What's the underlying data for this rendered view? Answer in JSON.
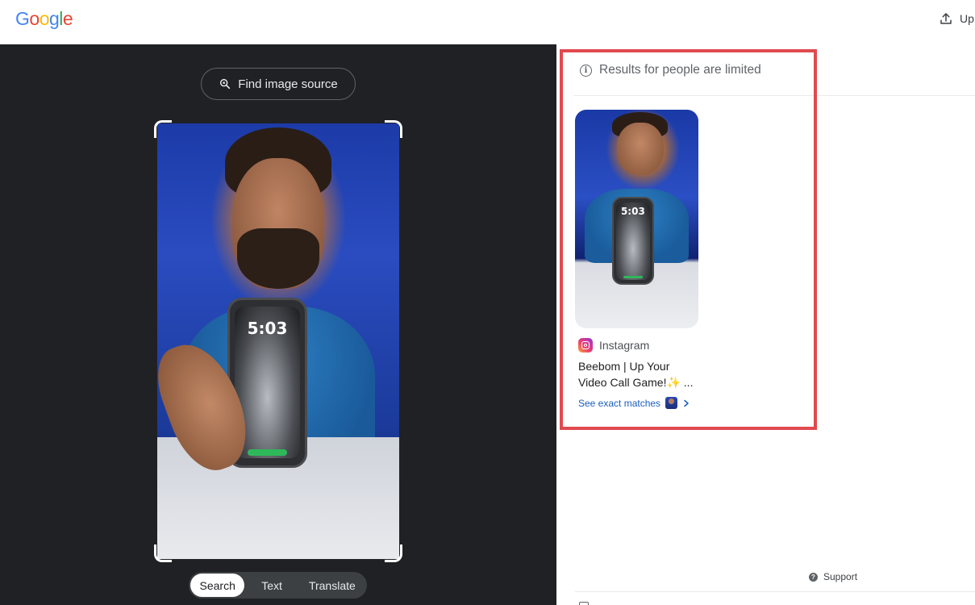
{
  "header": {
    "logo_letters": [
      {
        "char": "G",
        "color": "#4285f4"
      },
      {
        "char": "o",
        "color": "#ea4335"
      },
      {
        "char": "o",
        "color": "#fbbc05"
      },
      {
        "char": "g",
        "color": "#4285f4"
      },
      {
        "char": "l",
        "color": "#34a853"
      },
      {
        "char": "e",
        "color": "#ea4335"
      }
    ],
    "upload_label": "Up",
    "upload_icon": "upload-icon"
  },
  "left_panel": {
    "find_source_label": "Find image source",
    "find_source_icon": "lens-search-icon",
    "query_image": {
      "phone_time": "5:03"
    },
    "modes": [
      {
        "label": "Search",
        "active": true
      },
      {
        "label": "Text",
        "active": false
      },
      {
        "label": "Translate",
        "active": false
      }
    ]
  },
  "results": {
    "notice": "Results for people are limited",
    "notice_icon": "info-icon",
    "highlight_color": "#e04a4f",
    "items": [
      {
        "thumbnail_phone_time": "5:03",
        "source": "Instagram",
        "source_icon": "instagram-icon",
        "title": "Beebom | Up Your Video Call Game!✨ ...",
        "exact_matches_label": "See exact matches",
        "exact_matches_icon": "chevron-right-icon"
      }
    ]
  },
  "footer": {
    "support_label": "Support",
    "support_icon": "help-circle-icon"
  }
}
